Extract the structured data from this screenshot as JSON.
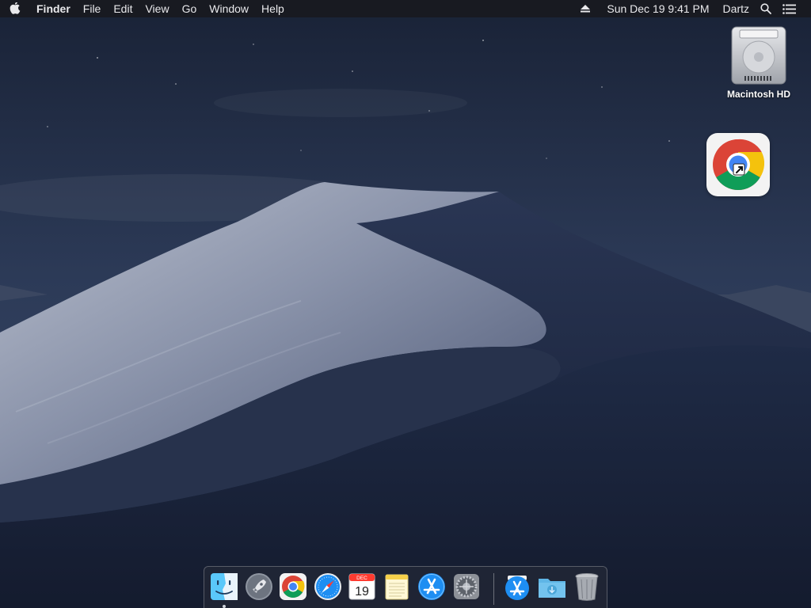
{
  "menubar": {
    "apple_icon": "apple-logo-icon",
    "app_name": "Finder",
    "menus": [
      "File",
      "Edit",
      "View",
      "Go",
      "Window",
      "Help"
    ],
    "status": {
      "eject_icon": "eject-icon",
      "datetime": "Sun Dec 19  9:41 PM",
      "user": "Dartz",
      "search_icon": "spotlight-search-icon",
      "notification_icon": "notification-center-icon"
    }
  },
  "desktop": {
    "icons": [
      {
        "label": "Macintosh HD",
        "icon": "hard-drive-icon"
      },
      {
        "label": "",
        "icon": "google-chrome-alias-icon"
      }
    ]
  },
  "dock": {
    "apps": [
      {
        "name": "Finder",
        "icon": "finder-icon",
        "running": true
      },
      {
        "name": "Launchpad",
        "icon": "launchpad-icon",
        "running": false
      },
      {
        "name": "Google Chrome",
        "icon": "chrome-icon",
        "running": false
      },
      {
        "name": "Safari",
        "icon": "safari-icon",
        "running": false
      },
      {
        "name": "Calendar",
        "icon": "calendar-icon",
        "running": false,
        "month": "DEC",
        "day": "19"
      },
      {
        "name": "Notes",
        "icon": "notes-icon",
        "running": false
      },
      {
        "name": "App Store",
        "icon": "app-store-icon",
        "running": false
      },
      {
        "name": "System Preferences",
        "icon": "system-preferences-icon",
        "running": false
      }
    ],
    "others": [
      {
        "name": "Applications",
        "icon": "applications-stack-icon"
      },
      {
        "name": "Downloads",
        "icon": "downloads-folder-icon"
      },
      {
        "name": "Trash",
        "icon": "trash-icon"
      }
    ]
  },
  "colors": {
    "menubar_bg": "#181a20",
    "sky_top": "#1b2438",
    "sky_bottom": "#3a4a66",
    "dune_light": "#a9b0c2",
    "dune_dark": "#1e2a45",
    "chrome_red": "#db4437",
    "chrome_yellow": "#f4c20d",
    "chrome_green": "#0f9d58",
    "chrome_blue": "#4285f4"
  }
}
